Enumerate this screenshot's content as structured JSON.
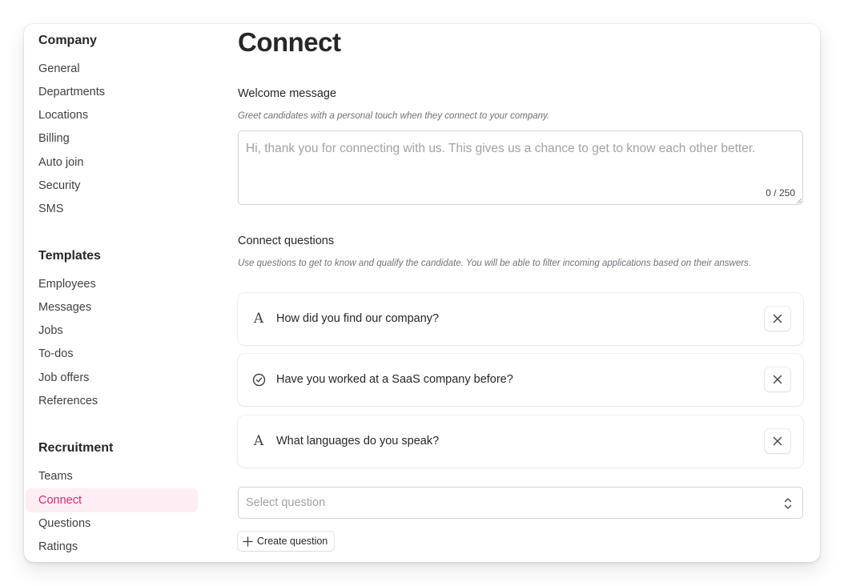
{
  "sidebar": {
    "sections": [
      {
        "title": "Company",
        "items": [
          {
            "label": "General"
          },
          {
            "label": "Departments"
          },
          {
            "label": "Locations"
          },
          {
            "label": "Billing"
          },
          {
            "label": "Auto join"
          },
          {
            "label": "Security"
          },
          {
            "label": "SMS"
          }
        ]
      },
      {
        "title": "Templates",
        "items": [
          {
            "label": "Employees"
          },
          {
            "label": "Messages"
          },
          {
            "label": "Jobs"
          },
          {
            "label": "To-dos"
          },
          {
            "label": "Job offers"
          },
          {
            "label": "References"
          }
        ]
      },
      {
        "title": "Recruitment",
        "items": [
          {
            "label": "Teams"
          },
          {
            "label": "Connect",
            "active": true
          },
          {
            "label": "Questions"
          },
          {
            "label": "Ratings"
          }
        ]
      }
    ],
    "active_color": "#db2777",
    "active_bg": "#fdeef4"
  },
  "main": {
    "title": "Connect",
    "welcome": {
      "label": "Welcome message",
      "description": "Greet candidates with a personal touch when they connect to your company.",
      "value": "",
      "placeholder": "Hi, thank you for connecting with us. This gives us a chance to get to know each other better.",
      "char_count": "0 / 250"
    },
    "questions": {
      "label": "Connect questions",
      "description": "Use questions to get to know and qualify the candidate. You will be able to filter incoming applications based on their answers.",
      "items": [
        {
          "text": "How did you find our company?",
          "type_icon": "text-type-icon"
        },
        {
          "text": "Have you worked at a SaaS company before?",
          "type_icon": "check-circle-icon"
        },
        {
          "text": "What languages do you speak?",
          "type_icon": "text-type-icon"
        }
      ],
      "select_placeholder": "Select question",
      "create_label": "Create question"
    }
  }
}
